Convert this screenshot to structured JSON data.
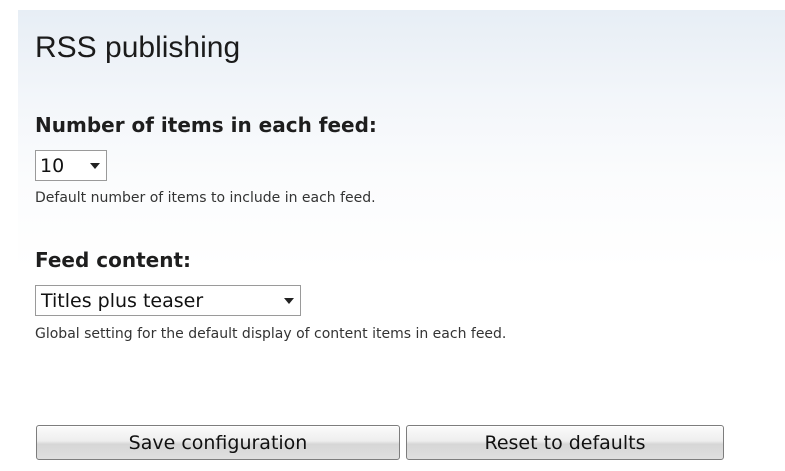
{
  "page": {
    "title": "RSS publishing"
  },
  "form": {
    "items_per_feed": {
      "label": "Number of items in each feed:",
      "selected_value": "10",
      "description": "Default number of items to include in each feed."
    },
    "feed_content": {
      "label": "Feed content:",
      "selected_value": "Titles plus teaser",
      "description": "Global setting for the default display of content items in each feed."
    }
  },
  "actions": {
    "save_label": "Save configuration",
    "reset_label": "Reset to defaults"
  },
  "icons": {
    "dropdown_arrow": "chevron-down-icon"
  },
  "colors": {
    "panel_gradient_top": "#e7eef5",
    "button_face": "#e6e6e6",
    "button_border": "#7d7d7d"
  }
}
